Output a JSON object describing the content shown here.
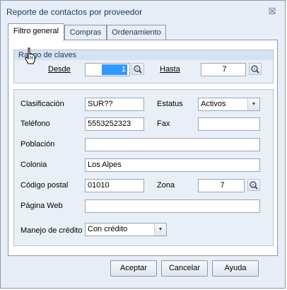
{
  "window": {
    "title": "Reporte de contactos por proveedor",
    "close_glyph": "☒"
  },
  "tabs": [
    {
      "label": "Filtro general",
      "active": true
    },
    {
      "label": "Compras",
      "active": false
    },
    {
      "label": "Ordenamiento",
      "active": false
    }
  ],
  "rango": {
    "title": "Rango de claves",
    "desde_label": "Desde",
    "desde_value": "1",
    "hasta_label": "Hasta",
    "hasta_value": "7"
  },
  "form": {
    "clasificacion": {
      "label": "Clasificación",
      "value": "SUR??"
    },
    "estatus": {
      "label": "Estatus",
      "value": "Activos"
    },
    "telefono": {
      "label": "Teléfono",
      "value": "5553252323"
    },
    "fax": {
      "label": "Fax",
      "value": ""
    },
    "poblacion": {
      "label": "Población",
      "value": ""
    },
    "colonia": {
      "label": "Colonia",
      "value": "Los Alpes"
    },
    "codigo_postal": {
      "label": "Código postal",
      "value": "01010"
    },
    "zona": {
      "label": "Zona",
      "value": "7"
    },
    "pagina_web": {
      "label": "Página Web",
      "value": ""
    },
    "manejo_credito": {
      "label": "Manejo de crédito",
      "value": "Con crédito"
    }
  },
  "buttons": {
    "aceptar": "Aceptar",
    "cancelar": "Cancelar",
    "ayuda": "Ayuda"
  },
  "icons": {
    "lookup": "binoculars-icon",
    "dropdown": "chevron-down-icon"
  },
  "colors": {
    "window_bg": "#e7eef7",
    "selection": "#3399ff",
    "title_text": "#1e395b"
  }
}
